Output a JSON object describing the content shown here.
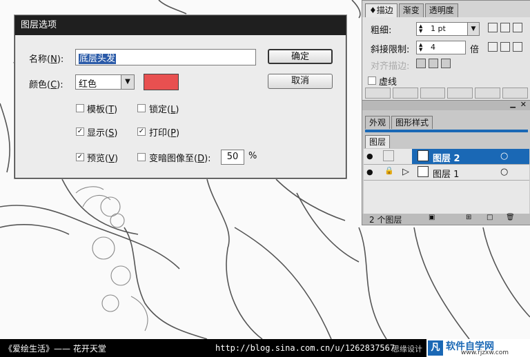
{
  "dialog": {
    "title": "图层选项",
    "name_label": "名称",
    "name_key": "N",
    "name_value": "底层头发",
    "color_label": "颜色",
    "color_key": "C",
    "color_value": "红色",
    "swatch_color": "#e85050",
    "ok_label": "确定",
    "cancel_label": "取消",
    "template_label": "模板",
    "template_key": "T",
    "template_checked": false,
    "lock_label": "锁定",
    "lock_key": "L",
    "lock_checked": false,
    "show_label": "显示",
    "show_key": "S",
    "show_checked": true,
    "print_label": "打印",
    "print_key": "P",
    "print_checked": true,
    "preview_label": "预览",
    "preview_key": "V",
    "preview_checked": true,
    "dim_label": "变暗图像至",
    "dim_key": "D",
    "dim_checked": false,
    "dim_value": "50",
    "dim_unit": "%"
  },
  "stroke_panel": {
    "tabs": [
      "描边",
      "渐变",
      "透明度"
    ],
    "weight_label": "粗细:",
    "weight_value": "1 pt",
    "miter_label": "斜接限制:",
    "miter_value": "4",
    "miter_unit": "倍",
    "align_label": "对齐描边:",
    "dashed_label": "虚线"
  },
  "layers_panel": {
    "tabs_top": [
      "外观",
      "图形样式"
    ],
    "tab_layers": "图层",
    "layers": [
      {
        "name": "图层 2",
        "selected": true,
        "locked": false
      },
      {
        "name": "图层 1",
        "selected": false,
        "locked": true
      }
    ],
    "count_text": "2 个图层"
  },
  "footer": {
    "left_text": "《爱绘生活》—— 花开天堂",
    "url_text": "http://blog.sina.com.cn/u/1262837567",
    "watermark_left": "思缘设计",
    "watermark_logo": "软件自学网",
    "watermark_url": "www.rjzxw.com"
  },
  "colors": {
    "selection_blue": "#1a68b5",
    "dialog_title_bg": "#1f1f1f",
    "footer_bg": "#000000"
  }
}
